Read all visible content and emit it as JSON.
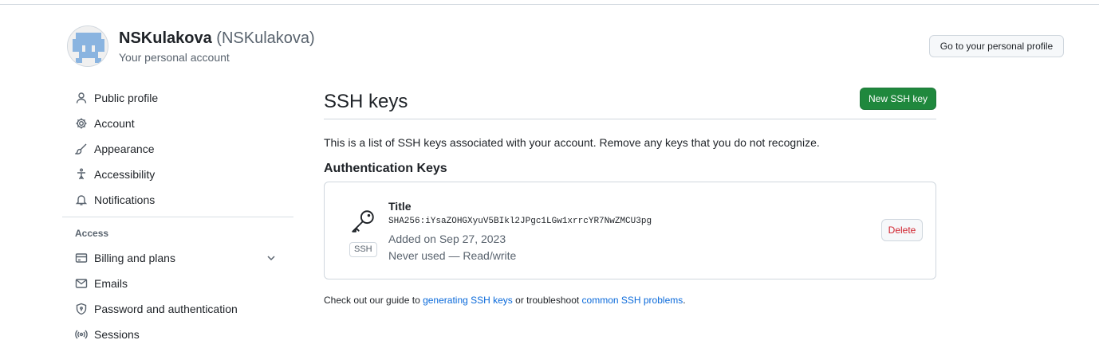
{
  "header": {
    "display_name": "NSKulakova",
    "handle": "(NSKulakova)",
    "subtitle": "Your personal account",
    "profile_button": "Go to your personal profile"
  },
  "sidebar": {
    "items": [
      {
        "label": "Public profile",
        "icon": "person-icon"
      },
      {
        "label": "Account",
        "icon": "gear-icon"
      },
      {
        "label": "Appearance",
        "icon": "paintbrush-icon"
      },
      {
        "label": "Accessibility",
        "icon": "accessibility-icon"
      },
      {
        "label": "Notifications",
        "icon": "bell-icon"
      }
    ],
    "group_label": "Access",
    "access_items": [
      {
        "label": "Billing and plans",
        "icon": "credit-card-icon"
      },
      {
        "label": "Emails",
        "icon": "mail-icon"
      },
      {
        "label": "Password and authentication",
        "icon": "shield-lock-icon"
      },
      {
        "label": "Sessions",
        "icon": "broadcast-icon"
      }
    ]
  },
  "main": {
    "title": "SSH keys",
    "new_button": "New SSH key",
    "description": "This is a list of SSH keys associated with your account. Remove any keys that you do not recognize.",
    "section_title": "Authentication Keys",
    "key": {
      "badge": "SSH",
      "title": "Title",
      "fingerprint": "SHA256:iYsaZOHGXyuV5BIkl2JPgc1LGw1xrrcYR7NwZMCU3pg",
      "added": "Added on Sep 27, 2023",
      "usage": "Never used — Read/write",
      "delete_button": "Delete"
    },
    "guide": {
      "prefix": "Check out our guide to ",
      "link1": "generating SSH keys",
      "middle": " or troubleshoot ",
      "link2": "common SSH problems",
      "suffix": "."
    }
  },
  "colors": {
    "accent_green": "#1f883d",
    "link_blue": "#0969da",
    "danger_red": "#d1242f",
    "muted_text": "#59636e",
    "border": "#d0d7de"
  }
}
